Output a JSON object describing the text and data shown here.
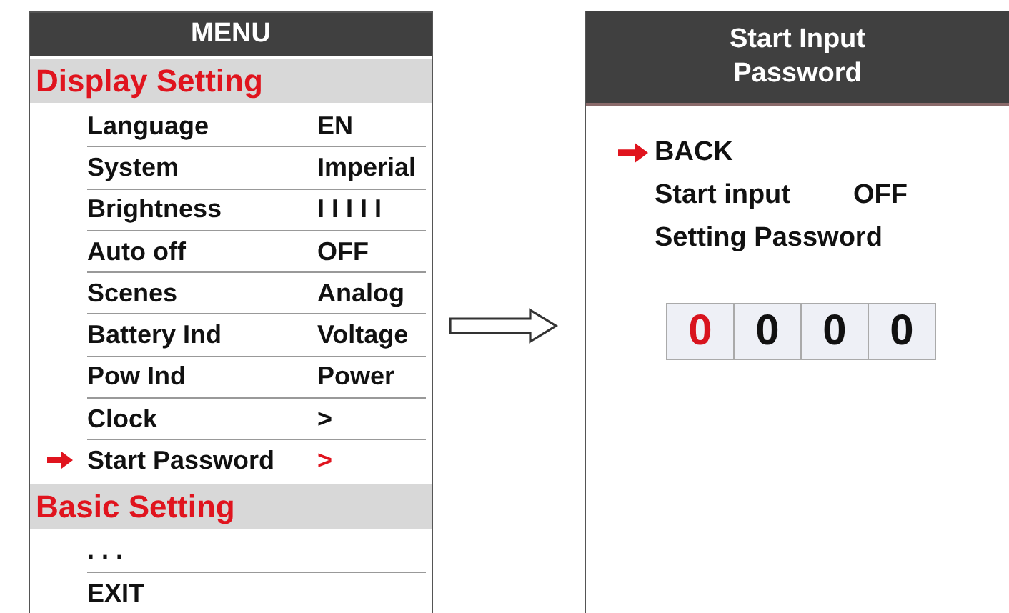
{
  "menu_screen": {
    "title": "MENU",
    "sections": [
      {
        "title": "Display Setting",
        "items": [
          {
            "label": "Language",
            "value": "EN",
            "selected": false
          },
          {
            "label": "System",
            "value": "Imperial",
            "selected": false
          },
          {
            "label": "Brightness",
            "value": "I I I I I",
            "selected": false
          },
          {
            "label": "Auto off",
            "value": "OFF",
            "selected": false
          },
          {
            "label": "Scenes",
            "value": "Analog",
            "selected": false
          },
          {
            "label": "Battery Ind",
            "value": "Voltage",
            "selected": false
          },
          {
            "label": "Pow Ind",
            "value": "Power",
            "selected": false
          },
          {
            "label": "Clock",
            "value": ">",
            "selected": false
          },
          {
            "label": "Start Password",
            "value": ">",
            "selected": true
          }
        ]
      },
      {
        "title": "Basic Setting",
        "items": [
          {
            "label": ". . .",
            "selected": false
          },
          {
            "label": "EXIT",
            "selected": false
          }
        ]
      }
    ]
  },
  "password_screen": {
    "title": "Start Input Password",
    "items": [
      {
        "label": "BACK",
        "selected": true
      },
      {
        "label": "Start input",
        "value": "OFF",
        "selected": false
      },
      {
        "label": "Setting Password",
        "selected": false
      }
    ],
    "digits": [
      {
        "digit": "0",
        "selected": true
      },
      {
        "digit": "0",
        "selected": false
      },
      {
        "digit": "0",
        "selected": false
      },
      {
        "digit": "0",
        "selected": false
      }
    ]
  }
}
